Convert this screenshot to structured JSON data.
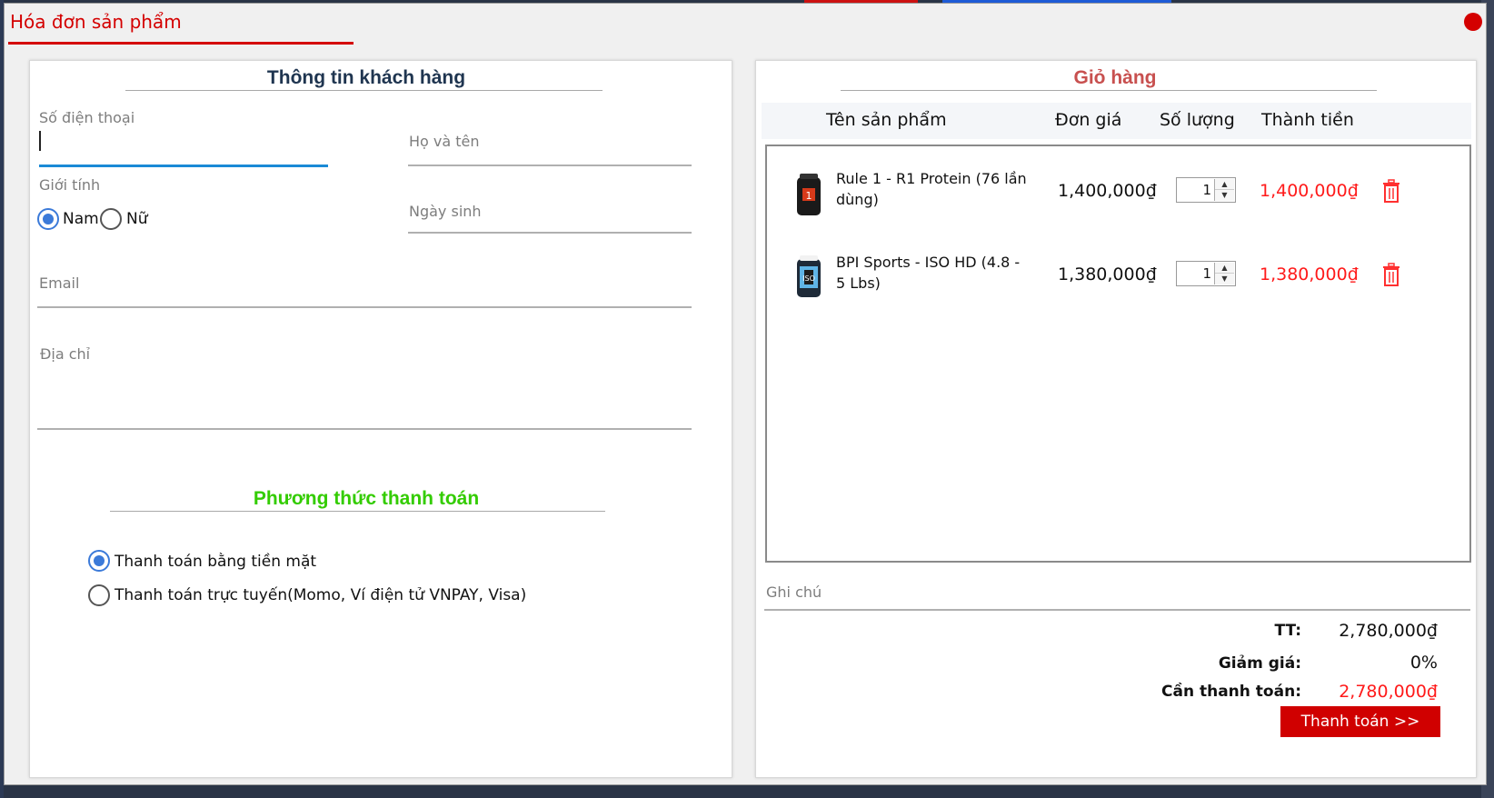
{
  "dialog": {
    "title": "Hóa đơn sản phẩm",
    "accent_color": "#d40000"
  },
  "customer": {
    "section_title": "Thông tin khách hàng",
    "phone_label": "Số điện thoại",
    "phone_value": "",
    "name_label": "Họ và tên",
    "gender_label": "Giới tính",
    "gender_options": [
      "Nam",
      "Nữ"
    ],
    "gender_selected": "Nam",
    "birthday_label": "Ngày sinh",
    "email_label": "Email",
    "address_label": "Địa chỉ"
  },
  "payment": {
    "section_title": "Phương thức thanh toán",
    "title_color": "#33cc00",
    "options": [
      "Thanh toán bằng tiền mặt",
      "Thanh toán trực tuyến(Momo, Ví điện tử VNPAY, Visa)"
    ],
    "selected": "Thanh toán bằng tiền mặt"
  },
  "cart": {
    "section_title": "Giỏ hàng",
    "title_color": "#c8504f",
    "columns": [
      "Tên sản phẩm",
      "Đơn giá",
      "Số lượng",
      "Thành tiền"
    ],
    "items": [
      {
        "name": "Rule 1 - R1 Protein (76 lần dùng)",
        "price": "1,400,000₫",
        "quantity": "1",
        "total": "1,400,000₫",
        "icon": "protein-tub-icon"
      },
      {
        "name": "BPI Sports - ISO HD (4.8 - 5 Lbs)",
        "price": "1,380,000₫",
        "quantity": "1",
        "total": "1,380,000₫",
        "icon": "protein-tub-icon"
      }
    ],
    "note_label": "Ghi chú"
  },
  "summary": {
    "subtotal_label": "TT:",
    "subtotal_value": "2,780,000₫",
    "discount_label": "Giảm giá:",
    "discount_value": "0%",
    "due_label": "Cần thanh toán:",
    "due_value": "2,780,000₫",
    "due_color": "#ff1a1a",
    "pay_button_label": "Thanh toán >>"
  }
}
